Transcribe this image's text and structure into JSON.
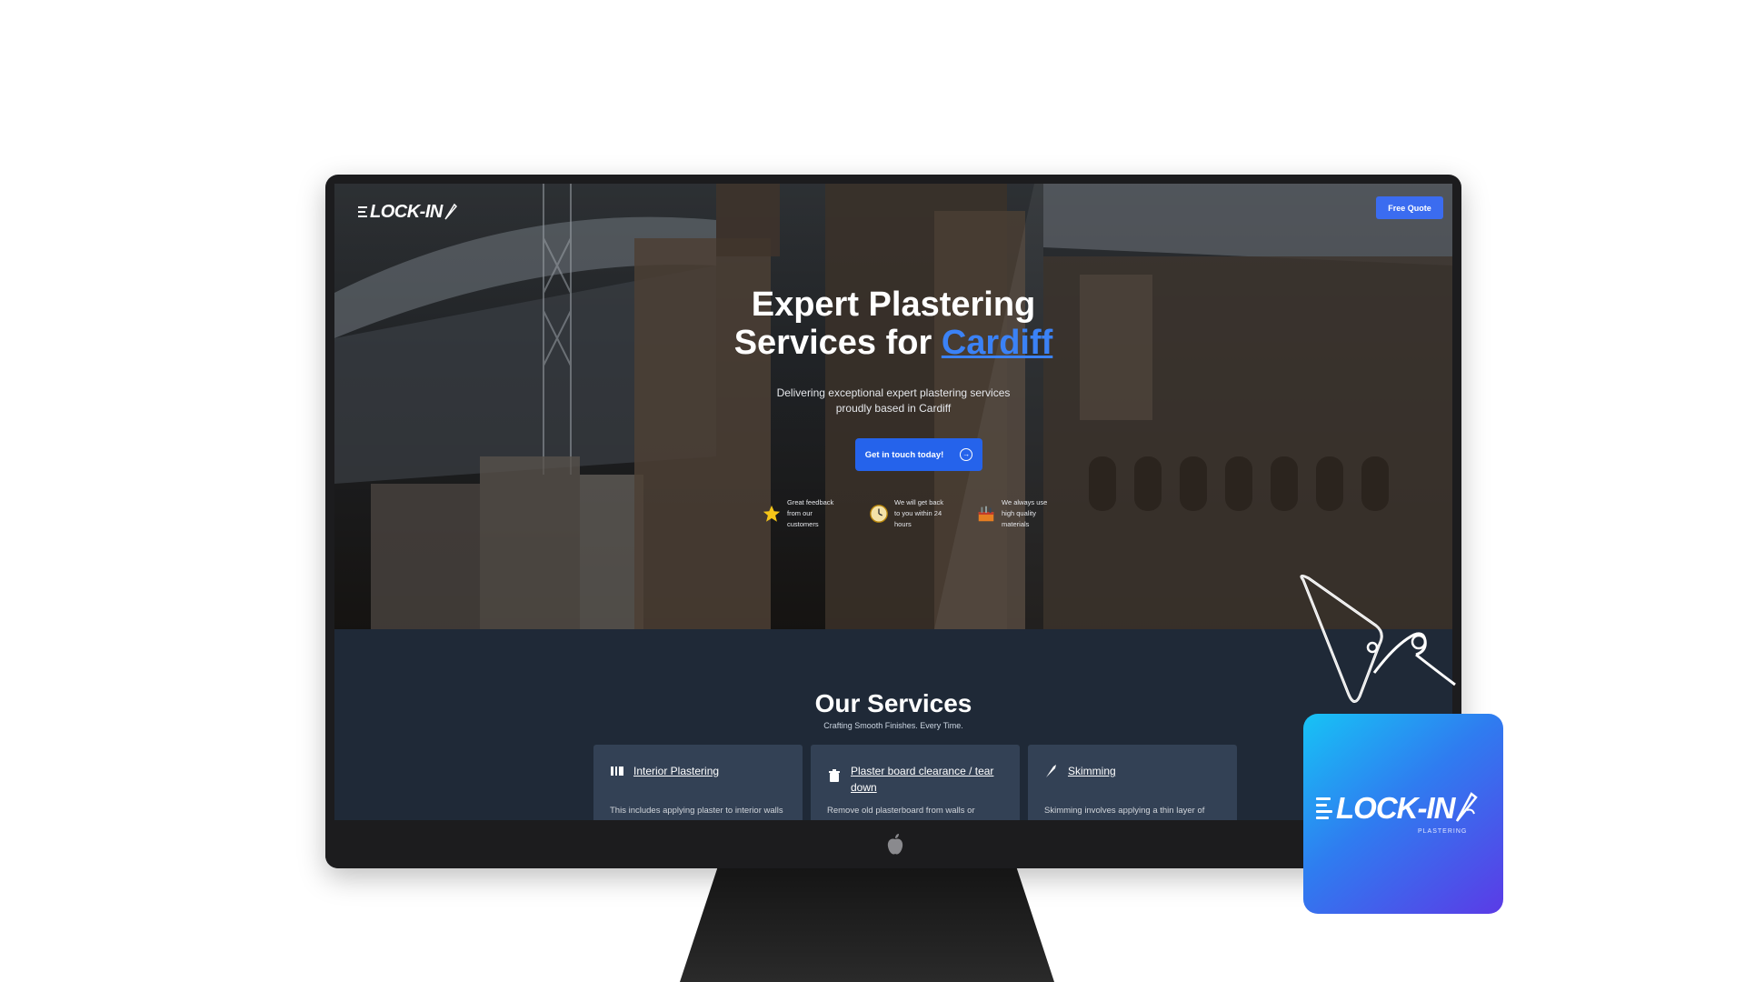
{
  "header": {
    "logo_text": "LOCK-IN",
    "free_quote_label": "Free Quote"
  },
  "hero": {
    "title_line1": "Expert Plastering",
    "title_prefix": "Services for ",
    "title_accent": "Cardiff",
    "subtitle": "Delivering exceptional expert plastering services proudly based in Cardiff",
    "cta_label": "Get in touch today!",
    "features": [
      {
        "icon": "star-icon",
        "text": "Great feedback from our customers"
      },
      {
        "icon": "clock-icon",
        "text": "We will get back to you within 24 hours"
      },
      {
        "icon": "toolbox-icon",
        "text": "We always use high quality materials"
      }
    ]
  },
  "services": {
    "title": "Our Services",
    "subtitle": "Crafting Smooth Finishes. Every Time.",
    "cards": [
      {
        "icon": "wall-icon",
        "title": "Interior Plastering",
        "description": "This includes applying plaster to interior walls and ceilings, creating smooth and even"
      },
      {
        "icon": "trash-icon",
        "title": "Plaster board clearance / tear down",
        "description": "Remove old plasterboard from walls or ceilings"
      },
      {
        "icon": "trowel-icon",
        "title": "Skimming",
        "description": "Skimming involves applying a thin layer of plaster to existing walls or ceilings to create a"
      }
    ]
  },
  "app_icon": {
    "logo_text": "LOCK-IN",
    "tagline": "PLASTERING"
  },
  "colors": {
    "accent": "#2563eb",
    "hero_overlay": "#000000",
    "services_bg": "#1f2937",
    "card_bg": "#334155",
    "tile_gradient_start": "#17c3f5",
    "tile_gradient_end": "#5b3be6"
  }
}
